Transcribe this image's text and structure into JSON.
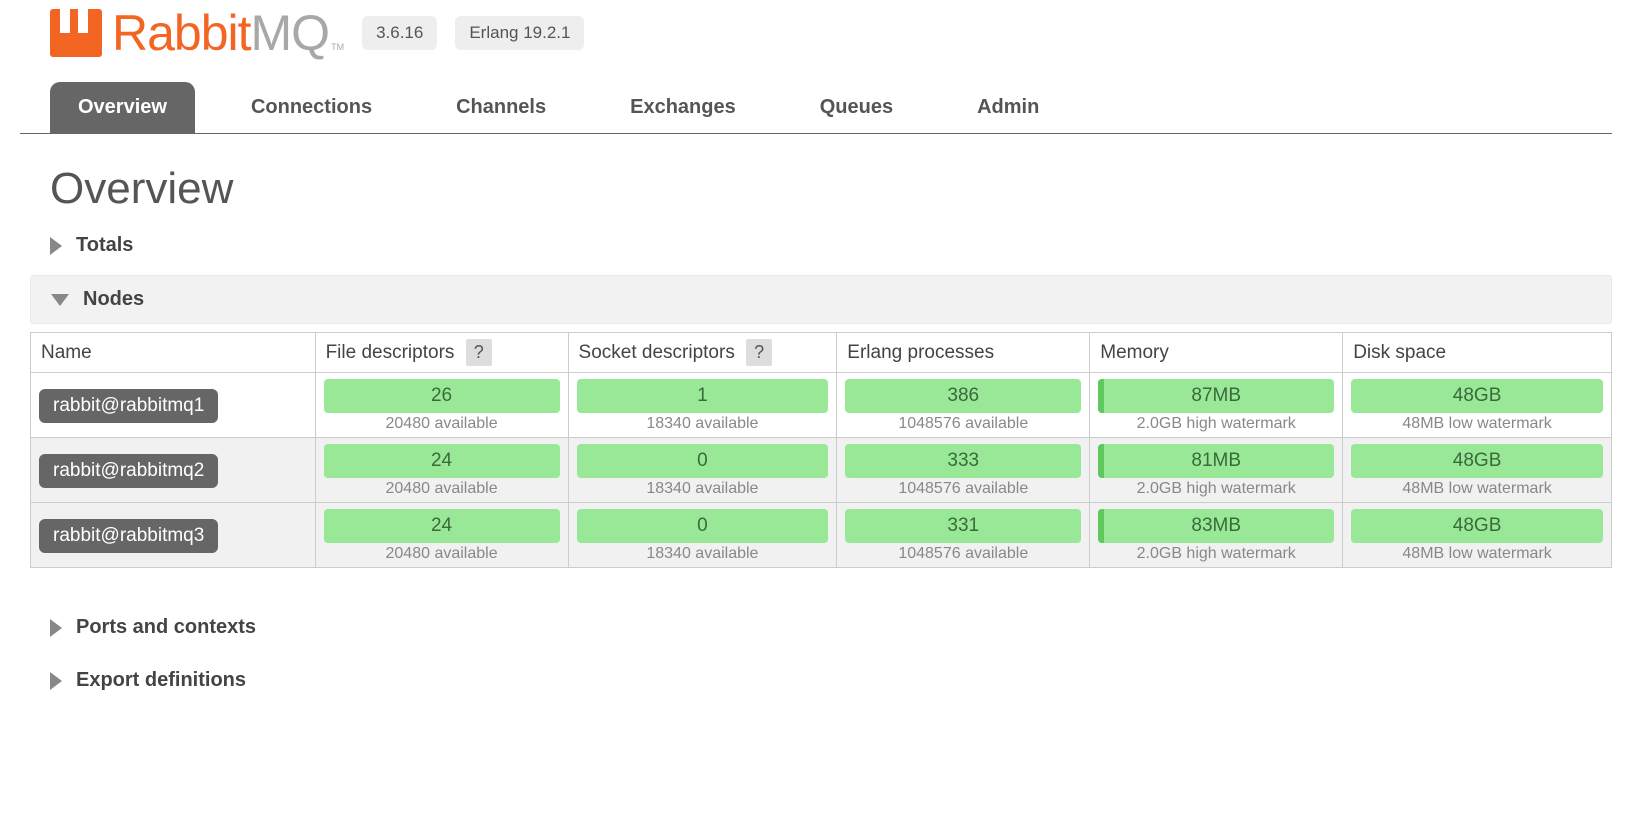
{
  "header": {
    "logo_text_a": "Rabbit",
    "logo_text_b": "MQ",
    "tm": "TM",
    "version": "3.6.16",
    "erlang": "Erlang 19.2.1"
  },
  "tabs": {
    "overview": "Overview",
    "connections": "Connections",
    "channels": "Channels",
    "exchanges": "Exchanges",
    "queues": "Queues",
    "admin": "Admin"
  },
  "page_title": "Overview",
  "sections": {
    "totals": "Totals",
    "nodes": "Nodes",
    "ports": "Ports and contexts",
    "export": "Export definitions"
  },
  "nodes_table": {
    "help": "?",
    "headers": {
      "name": "Name",
      "fd": "File descriptors",
      "sd": "Socket descriptors",
      "ep": "Erlang processes",
      "mem": "Memory",
      "disk": "Disk space"
    },
    "rows": [
      {
        "name": "rabbit@rabbitmq1",
        "fd_val": "26",
        "fd_sub": "20480 available",
        "sd_val": "1",
        "sd_sub": "18340 available",
        "ep_val": "386",
        "ep_sub": "1048576 available",
        "mem_val": "87MB",
        "mem_sub": "2.0GB high watermark",
        "disk_val": "48GB",
        "disk_sub": "48MB low watermark"
      },
      {
        "name": "rabbit@rabbitmq2",
        "fd_val": "24",
        "fd_sub": "20480 available",
        "sd_val": "0",
        "sd_sub": "18340 available",
        "ep_val": "333",
        "ep_sub": "1048576 available",
        "mem_val": "81MB",
        "mem_sub": "2.0GB high watermark",
        "disk_val": "48GB",
        "disk_sub": "48MB low watermark"
      },
      {
        "name": "rabbit@rabbitmq3",
        "fd_val": "24",
        "fd_sub": "20480 available",
        "sd_val": "0",
        "sd_sub": "18340 available",
        "ep_val": "331",
        "ep_sub": "1048576 available",
        "mem_val": "83MB",
        "mem_sub": "2.0GB high watermark",
        "disk_val": "48GB",
        "disk_sub": "48MB low watermark"
      }
    ]
  }
}
